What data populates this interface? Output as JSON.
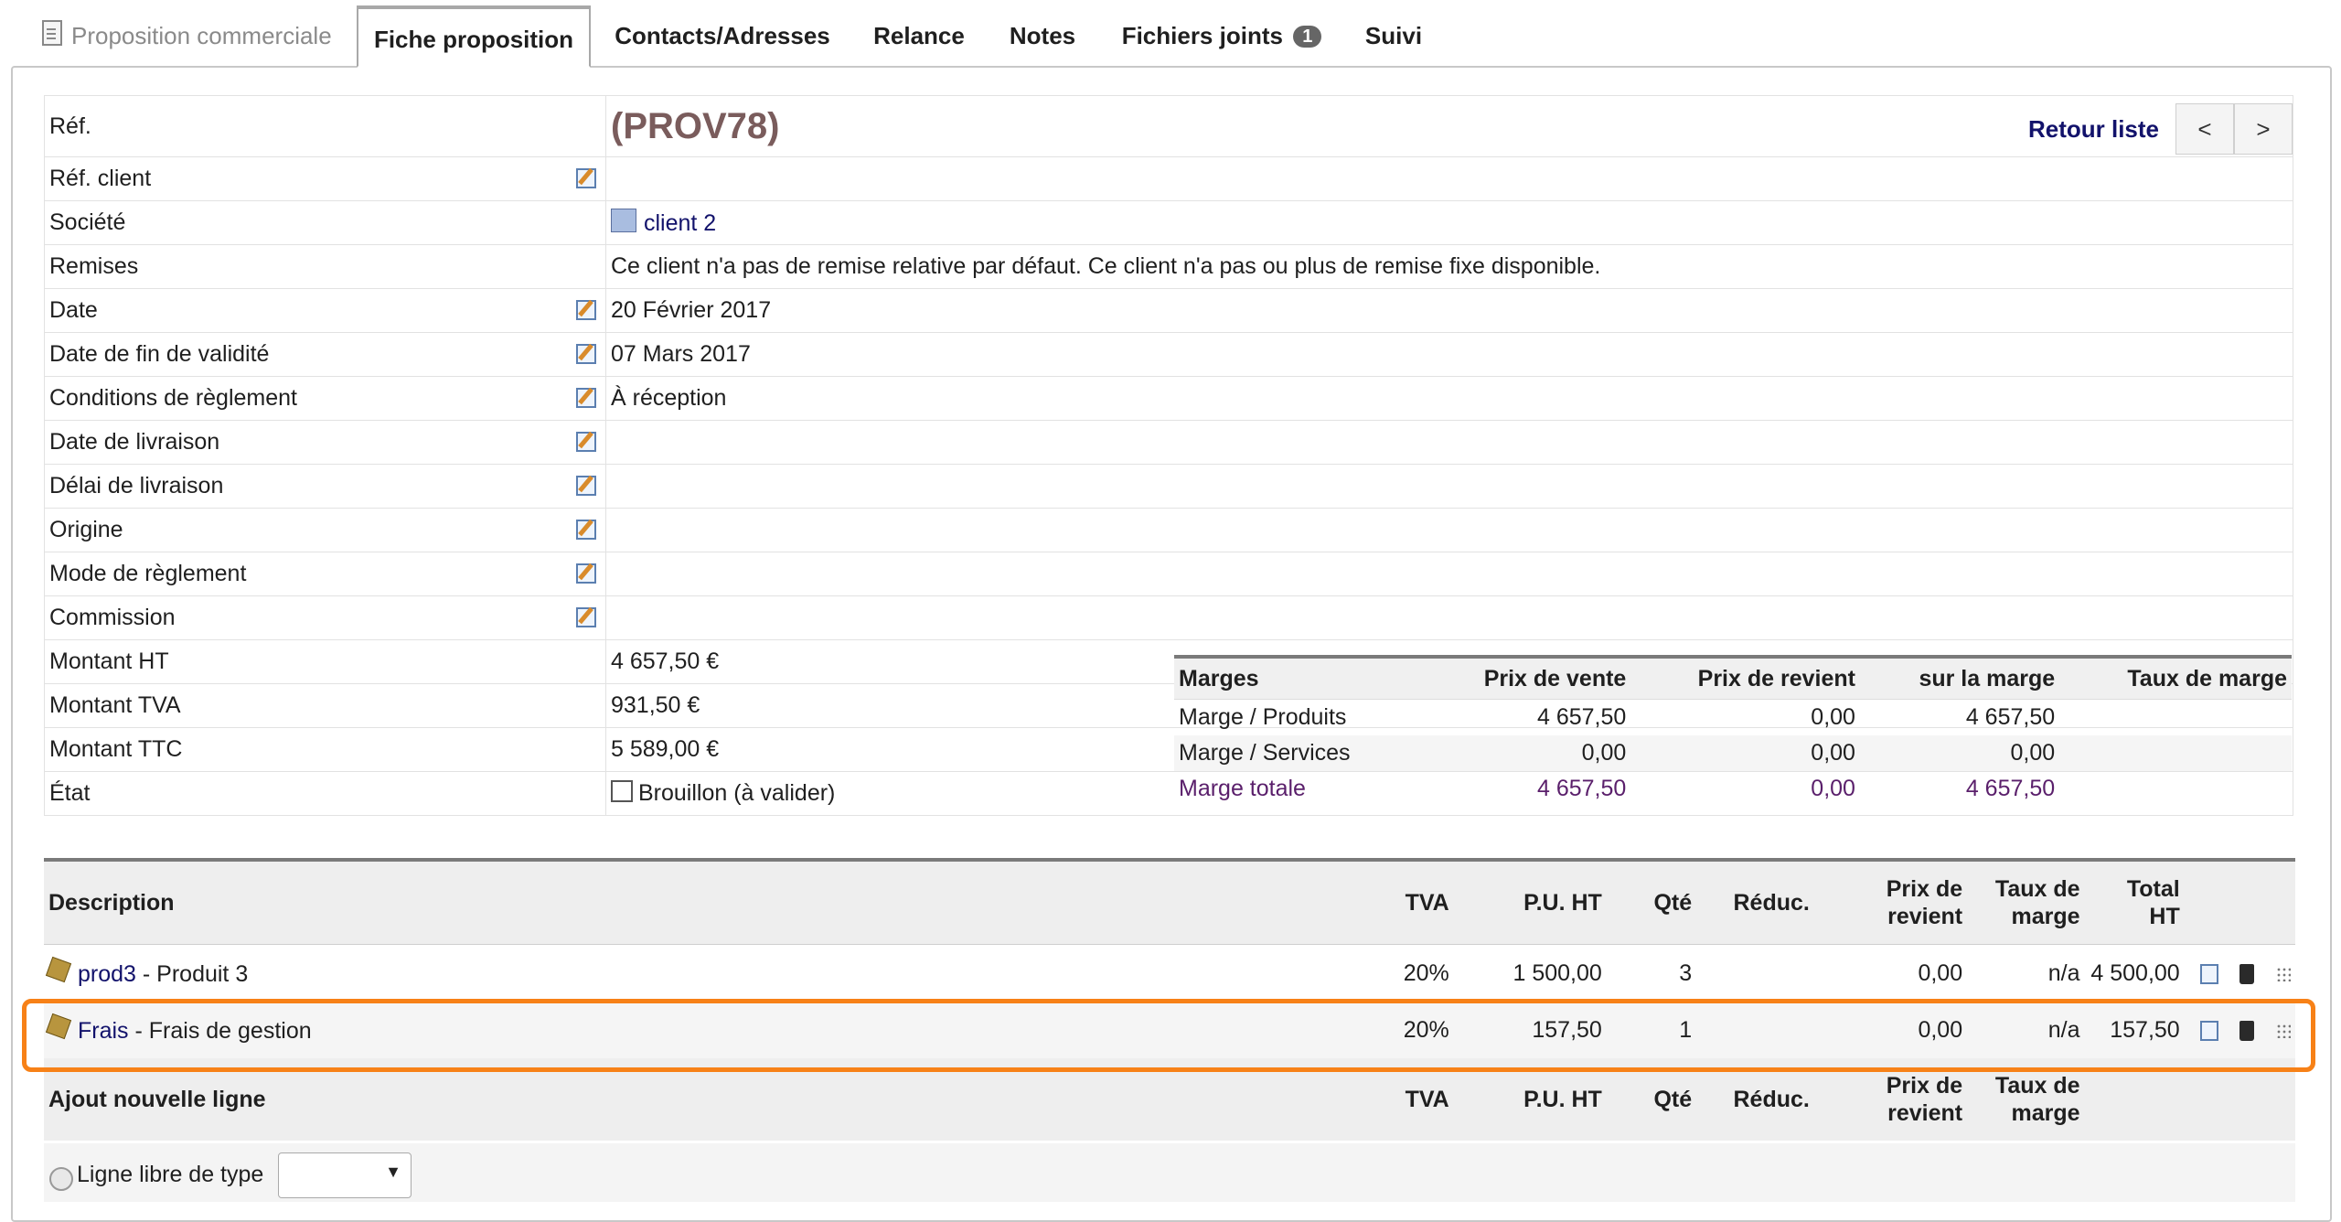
{
  "tabs": [
    {
      "label": "Proposition commerciale"
    },
    {
      "label": "Fiche proposition"
    },
    {
      "label": "Contacts/Adresses"
    },
    {
      "label": "Relance"
    },
    {
      "label": "Notes"
    },
    {
      "label": "Fichiers joints",
      "badge": "1"
    },
    {
      "label": "Suivi"
    }
  ],
  "nav": {
    "back_label": "Retour liste",
    "prev": "<",
    "next": ">"
  },
  "info": {
    "ref_label": "Réf.",
    "ref_value": "(PROV78)",
    "ref_client_label": "Réf. client",
    "societe_label": "Société",
    "societe_value": "client 2",
    "remises_label": "Remises",
    "remises_value": "Ce client n'a pas de remise relative par défaut. Ce client n'a pas ou plus de remise fixe disponible.",
    "date_label": "Date",
    "date_value": "20 Février 2017",
    "fin_label": "Date de fin de validité",
    "fin_value": "07 Mars 2017",
    "cond_label": "Conditions de règlement",
    "cond_value": "À réception",
    "livraison_label": "Date de livraison",
    "delai_label": "Délai de livraison",
    "origine_label": "Origine",
    "mode_label": "Mode de règlement",
    "commission_label": "Commission",
    "ht_label": "Montant HT",
    "ht_value": "4 657,50 €",
    "tva_label": "Montant TVA",
    "tva_value": "931,50 €",
    "ttc_label": "Montant TTC",
    "ttc_value": "5 589,00 €",
    "etat_label": "État",
    "etat_value": "Brouillon (à valider)"
  },
  "marges": {
    "headers": [
      "Marges",
      "Prix de vente",
      "Prix de revient",
      "sur la marge",
      "Taux de marge"
    ],
    "rows": [
      [
        "Marge / Produits",
        "4 657,50",
        "0,00",
        "4 657,50",
        ""
      ],
      [
        "Marge / Services",
        "0,00",
        "0,00",
        "0,00",
        ""
      ],
      [
        "Marge totale",
        "4 657,50",
        "0,00",
        "4 657,50",
        ""
      ]
    ]
  },
  "lines": {
    "headers": {
      "desc": "Description",
      "tva": "TVA",
      "pu": "P.U. HT",
      "qte": "Qté",
      "reduc": "Réduc.",
      "prix_rev_1": "Prix de",
      "prix_rev_2": "revient",
      "taux_1": "Taux de",
      "taux_2": "marge",
      "total_1": "Total",
      "total_2": "HT"
    },
    "rows": [
      {
        "ref": "prod3",
        "label": " - Produit 3",
        "tva": "20%",
        "pu": "1 500,00",
        "qte": "3",
        "reduc": "",
        "prix_rev": "0,00",
        "taux": "n/a",
        "total": "4 500,00"
      },
      {
        "ref": "Frais",
        "label": " - Frais de gestion",
        "tva": "20%",
        "pu": "157,50",
        "qte": "1",
        "reduc": "",
        "prix_rev": "0,00",
        "taux": "n/a",
        "total": "157,50"
      }
    ],
    "add_header": {
      "desc": "Ajout nouvelle ligne",
      "tva": "TVA",
      "pu": "P.U. HT",
      "qte": "Qté",
      "reduc": "Réduc.",
      "prix_rev_1": "Prix de",
      "prix_rev_2": "revient",
      "taux_1": "Taux de",
      "taux_2": "marge"
    },
    "free_line_label": "Ligne libre de type"
  }
}
